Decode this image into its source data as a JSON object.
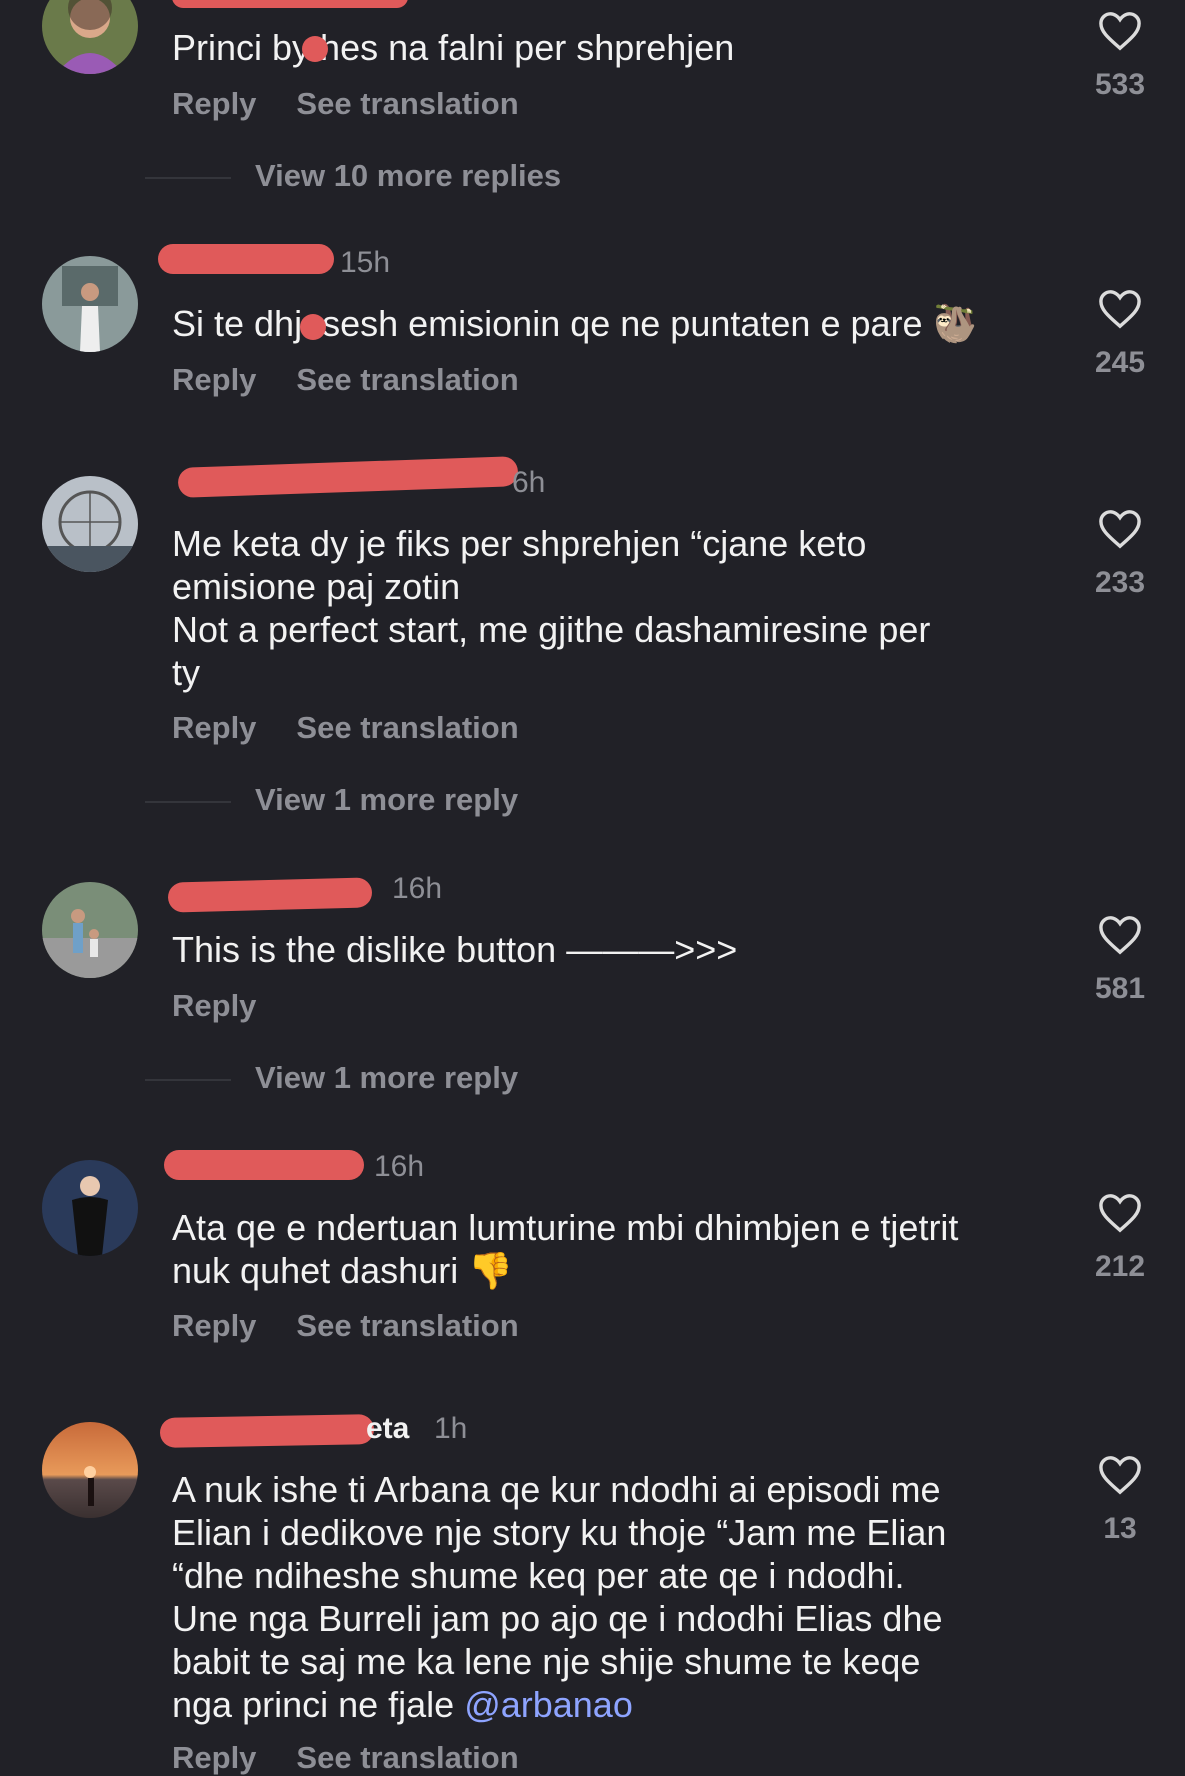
{
  "colors": {
    "background": "#212127",
    "muted": "#8e8f96",
    "mention": "#8ea4ff",
    "redaction": "#e05a5a"
  },
  "comments": [
    {
      "time": "",
      "text": "Princi bythes na falni per shprehjen",
      "reply": "Reply",
      "translate": "See translation",
      "likes": "533",
      "more": "View 10 more replies"
    },
    {
      "time": "15h",
      "text": "Si te dhjesesh emisionin qe ne puntaten e pare",
      "emoji": "🦥",
      "reply": "Reply",
      "translate": "See translation",
      "likes": "245"
    },
    {
      "time": "6h",
      "text": "Me keta dy je fiks per shprehjen “cjane keto\nemisione paj zotin\nNot a perfect start, me gjithe dashamiresine per\nty",
      "reply": "Reply",
      "translate": "See translation",
      "likes": "233",
      "more": "View 1 more reply"
    },
    {
      "time": "16h",
      "text": "This is the dislike button ———>>>",
      "reply": "Reply",
      "likes": "581",
      "more": "View 1 more reply"
    },
    {
      "time": "16h",
      "text": "Ata qe e ndertuan lumturine mbi dhimbjen e tjetrit\nnuk quhet dashuri",
      "emoji": "👎",
      "reply": "Reply",
      "translate": "See translation",
      "likes": "212"
    },
    {
      "name_tail": "eta",
      "time": "1h",
      "text": "A nuk ishe ti Arbana qe kur ndodhi ai episodi me\nElian i dedikove nje story ku thoje “Jam me Elian\n“dhe ndiheshe shume keq per ate qe i ndodhi.\nUne nga Burreli jam po ajo qe i ndodhi Elias dhe\nbabit te saj me ka lene nje shije shume te keqe\nnga princi ne fjale ",
      "mention": "@arbanao",
      "reply": "Reply",
      "translate": "See translation",
      "likes": "13"
    }
  ]
}
